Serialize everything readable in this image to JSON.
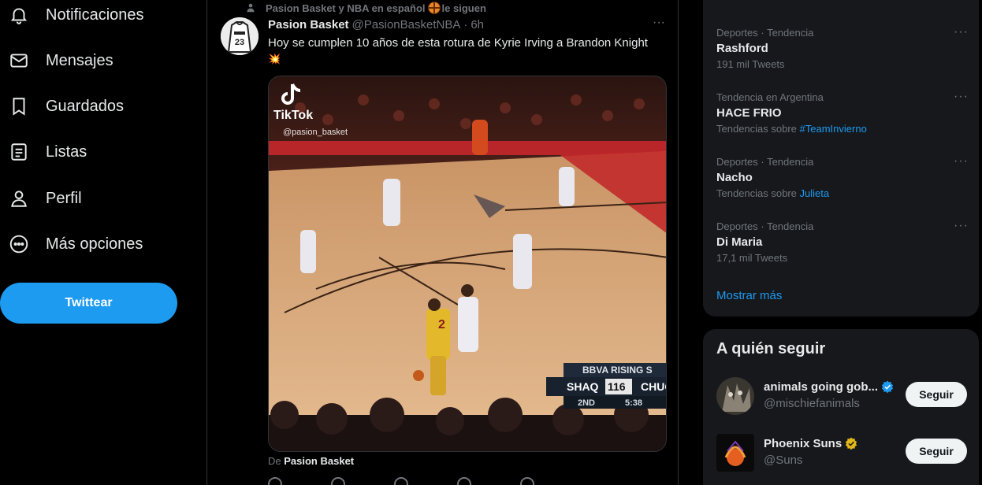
{
  "nav": {
    "items": [
      {
        "label": "Notificaciones",
        "icon": "bell-icon"
      },
      {
        "label": "Mensajes",
        "icon": "envelope-icon"
      },
      {
        "label": "Guardados",
        "icon": "bookmark-icon"
      },
      {
        "label": "Listas",
        "icon": "list-icon"
      },
      {
        "label": "Perfil",
        "icon": "person-icon"
      },
      {
        "label": "Más opciones",
        "icon": "more-circle-icon"
      }
    ],
    "tweet_button_label": "Twittear"
  },
  "tweet": {
    "context_prefix": "Pasion Basket y NBA en español",
    "context_suffix": "le siguen",
    "author_name": "Pasion Basket",
    "author_handle": "@PasionBasketNBA",
    "separator": "·",
    "time": "6h",
    "text": "Hoy se cumplen 10 años de esta rotura de Kyrie Irving a Brandon Knight",
    "text_emoji": "💥",
    "media": {
      "watermark_brand": "TikTok",
      "watermark_handle": "@pasion_basket",
      "banner": "BBVA RISING S",
      "team_left": "SHAQ",
      "score_left": "116",
      "team_right": "CHUC",
      "period": "2ND",
      "clock": "5:38",
      "jersey_number": "2"
    },
    "from_prefix": "De",
    "from_source": "Pasion Basket"
  },
  "trends": {
    "items": [
      {
        "meta": "Deportes · Tendencia",
        "name": "Rashford",
        "sub_text": "191 mil Tweets",
        "sub_link": ""
      },
      {
        "meta": "Tendencia en Argentina",
        "name": "HACE FRIO",
        "sub_text": "Tendencias sobre",
        "sub_link": "#TeamInvierno"
      },
      {
        "meta": "Deportes · Tendencia",
        "name": "Nacho",
        "sub_text": "Tendencias sobre",
        "sub_link": "Julieta"
      },
      {
        "meta": "Deportes · Tendencia",
        "name": "Di Maria",
        "sub_text": "17,1 mil Tweets",
        "sub_link": ""
      }
    ],
    "more_glyph": "···",
    "show_more": "Mostrar más"
  },
  "who_to_follow": {
    "title": "A quién seguir",
    "accounts": [
      {
        "name": "animals going gob...",
        "handle": "@mischiefanimals",
        "badge": "blue",
        "button": "Seguir"
      },
      {
        "name": "Phoenix Suns",
        "handle": "@Suns",
        "badge": "gold",
        "button": "Seguir"
      }
    ]
  },
  "colors": {
    "accent": "#1d9bf0",
    "background": "#000000",
    "card": "#16181c",
    "muted_text": "#71767b",
    "verified_gold": "#e2b719"
  }
}
